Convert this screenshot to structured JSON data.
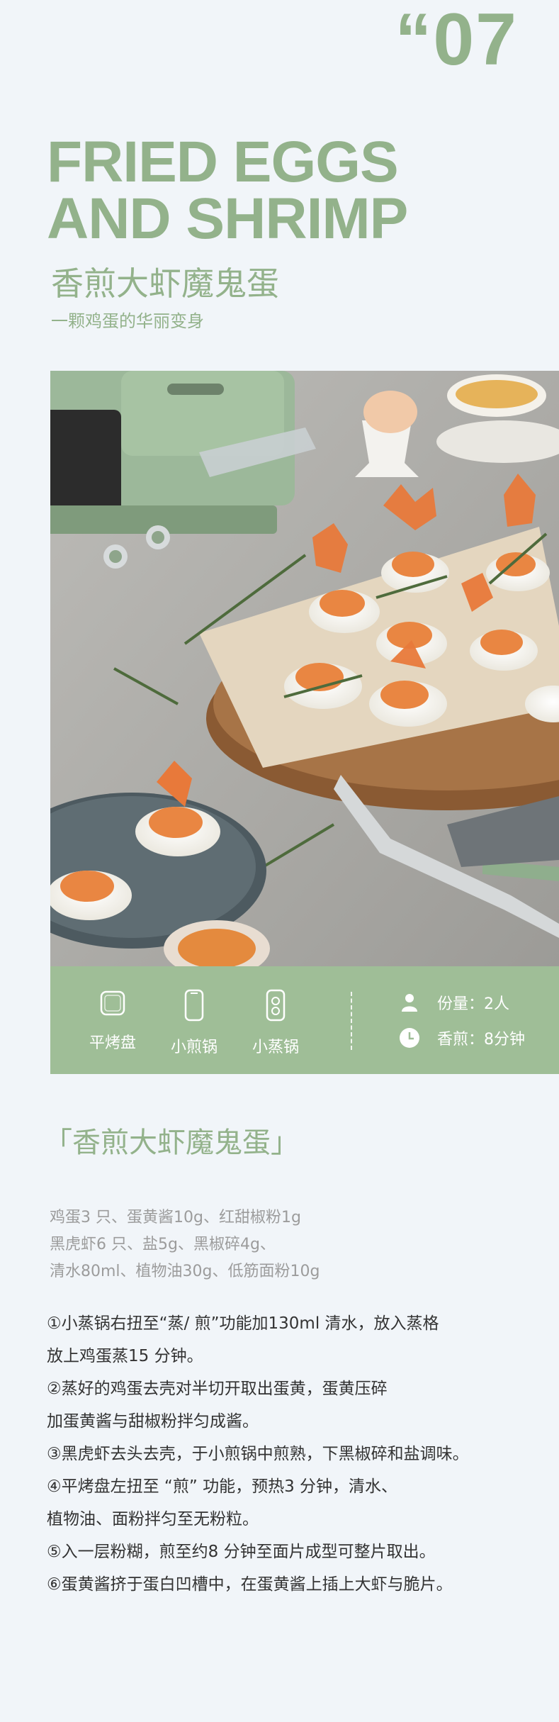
{
  "header": {
    "number": "“07",
    "title_en_line1": "FRIED EGGS",
    "title_en_line2": "AND SHRIMP",
    "title_cn": "香煎大虾魔鬼蛋",
    "subtitle_cn": "一颗鸡蛋的华丽变身"
  },
  "photo": {
    "description_icon": "fried-eggs-and-shrimp-photo"
  },
  "tools": [
    {
      "icon": "grill-plate-icon",
      "label": "平烤盘"
    },
    {
      "icon": "frying-pan-icon",
      "label": "小煎锅"
    },
    {
      "icon": "steamer-icon",
      "label": "小蒸锅"
    }
  ],
  "info": {
    "servings": "份量：2人",
    "time": "香煎：8分钟"
  },
  "recipe": {
    "section_title": "「香煎大虾魔鬼蛋」",
    "ingredients": [
      "鸡蛋3 只、蛋黄酱10g、红甜椒粉1g",
      "黑虎虾6 只、盐5g、黑椒碎4g、",
      "清水80ml、植物油30g、低筋面粉10g"
    ],
    "steps": [
      "①小蒸锅右扭至“蒸/ 煎”功能加130ml 清水，放入蒸格",
      "放上鸡蛋蒸15 分钟。",
      "②蒸好的鸡蛋去壳对半切开取出蛋黄，蛋黄压碎",
      "加蛋黄酱与甜椒粉拌匀成酱。",
      "③黑虎虾去头去壳，于小煎锅中煎熟，下黑椒碎和盐调味。",
      "④平烤盘左扭至 “煎” 功能，预热3 分钟，清水、",
      "植物油、面粉拌匀至无粉粒。",
      "⑤入一层粉糊，煎至约8 分钟至面片成型可整片取出。",
      "⑥蛋黄酱挤于蛋白凹槽中，在蛋黄酱上插上大虾与脆片。"
    ]
  },
  "colors": {
    "accent": "#93b28b",
    "bar": "#9fbe97",
    "background": "#f1f5f9"
  }
}
